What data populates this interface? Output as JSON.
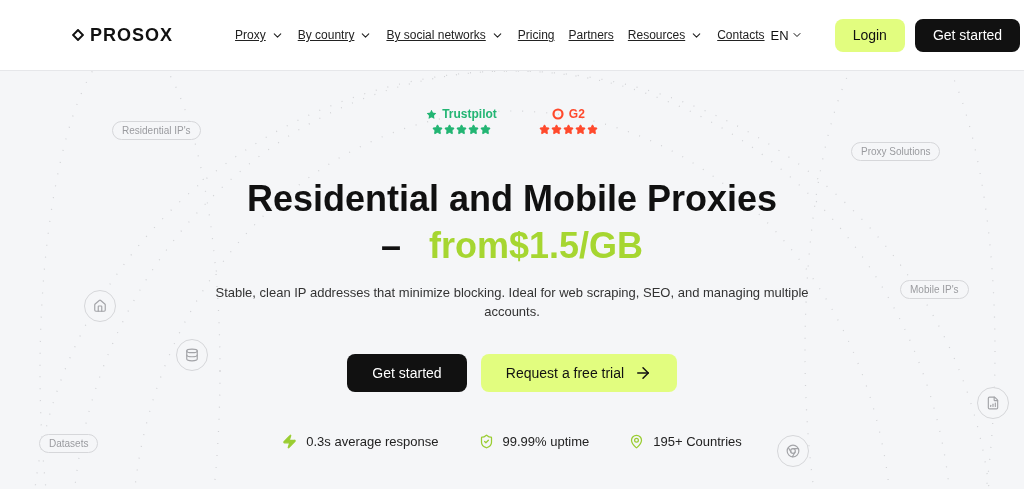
{
  "header": {
    "logo": "PROSOX",
    "nav": [
      {
        "label": "Proxy",
        "has_menu": true
      },
      {
        "label": "By country",
        "has_menu": true
      },
      {
        "label": "By social networks",
        "has_menu": true
      },
      {
        "label": "Pricing",
        "has_menu": false
      },
      {
        "label": "Partners",
        "has_menu": false
      },
      {
        "label": "Resources",
        "has_menu": true
      },
      {
        "label": "Contacts",
        "has_menu": false
      }
    ],
    "language": "EN",
    "login": "Login",
    "get_started": "Get started"
  },
  "ratings": [
    {
      "kind": "trustpilot",
      "label": "Trustpilot",
      "stars": 5,
      "color": "#22b573"
    },
    {
      "kind": "g2",
      "label": "G2",
      "stars": 5,
      "color": "#ff492c"
    }
  ],
  "tags": [
    {
      "kind": "pill",
      "label": "Residential IP's"
    },
    {
      "kind": "pill",
      "label": "Proxy Solutions"
    },
    {
      "kind": "pill",
      "label": "Mobile IP's"
    },
    {
      "kind": "pill",
      "label": "Datasets"
    },
    {
      "kind": "home"
    },
    {
      "kind": "database"
    },
    {
      "kind": "chrome"
    },
    {
      "kind": "report"
    }
  ],
  "hero": {
    "title": "Residential and Mobile Proxies",
    "dash": "–",
    "price": "from$1.5/GB",
    "subtitle": "Stable, clean IP addresses that minimize blocking. Ideal for web scraping, SEO, and managing multiple accounts.",
    "primary": "Get started",
    "secondary": "Request a free trial"
  },
  "stats": [
    {
      "kind": "bolt",
      "label": "0.3s average response"
    },
    {
      "kind": "shield",
      "label": "99.99% uptime"
    },
    {
      "kind": "pin",
      "label": "195+ Countries"
    }
  ]
}
